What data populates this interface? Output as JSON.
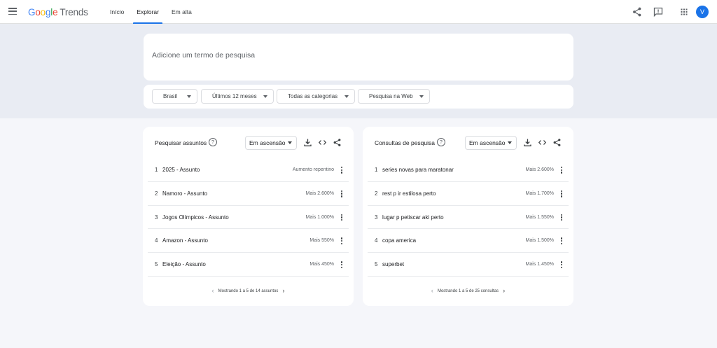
{
  "header": {
    "logo_google": [
      "G",
      "o",
      "o",
      "g",
      "l",
      "e"
    ],
    "logo_trends": "Trends",
    "nav": [
      {
        "label": "Início",
        "active": false
      },
      {
        "label": "Explorar",
        "active": true
      },
      {
        "label": "Em alta",
        "active": false
      }
    ],
    "avatar_initial": "V",
    "icons": [
      "menu-icon",
      "share-icon",
      "feedback-icon",
      "apps-icon"
    ]
  },
  "search": {
    "placeholder": "Adicione um termo de pesquisa",
    "value": ""
  },
  "filters": {
    "region": "Brasil",
    "time_range": "Últimos 12 meses",
    "category": "Todas as categorias",
    "search_type": "Pesquisa na Web"
  },
  "widgets": [
    {
      "title": "Pesquisar assuntos",
      "help_symbol": "?",
      "sort": "Em ascensão",
      "rows": [
        {
          "rank": "1",
          "term": "2025 - Assunto",
          "value": "Aumento repentino"
        },
        {
          "rank": "2",
          "term": "Namoro - Assunto",
          "value": "Mais 2.600%"
        },
        {
          "rank": "3",
          "term": "Jogos Olímpicos - Assunto",
          "value": "Mais 1.000%"
        },
        {
          "rank": "4",
          "term": "Amazon - Assunto",
          "value": "Mais 550%"
        },
        {
          "rank": "5",
          "term": "Eleição - Assunto",
          "value": "Mais 450%"
        }
      ],
      "pagination": "Mostrando 1 a 5 de 14 assuntos"
    },
    {
      "title": "Consultas de pesquisa",
      "help_symbol": "?",
      "sort": "Em ascensão",
      "rows": [
        {
          "rank": "1",
          "term": "series novas para maratonar",
          "value": "Mais 2.600%"
        },
        {
          "rank": "2",
          "term": "rest p ir estilosa perto",
          "value": "Mais 1.700%"
        },
        {
          "rank": "3",
          "term": "lugar p petiscar aki perto",
          "value": "Mais 1.550%"
        },
        {
          "rank": "4",
          "term": "copa america",
          "value": "Mais 1.500%"
        },
        {
          "rank": "5",
          "term": "superbet",
          "value": "Mais 1.450%"
        }
      ],
      "pagination": "Mostrando 1 a 5 de 25 consultas"
    }
  ],
  "colors": {
    "accent": "#1a73e8",
    "page_bg_top": "#e9ecf3",
    "page_bg_bottom": "#f5f6fa",
    "card_bg": "#ffffff"
  }
}
